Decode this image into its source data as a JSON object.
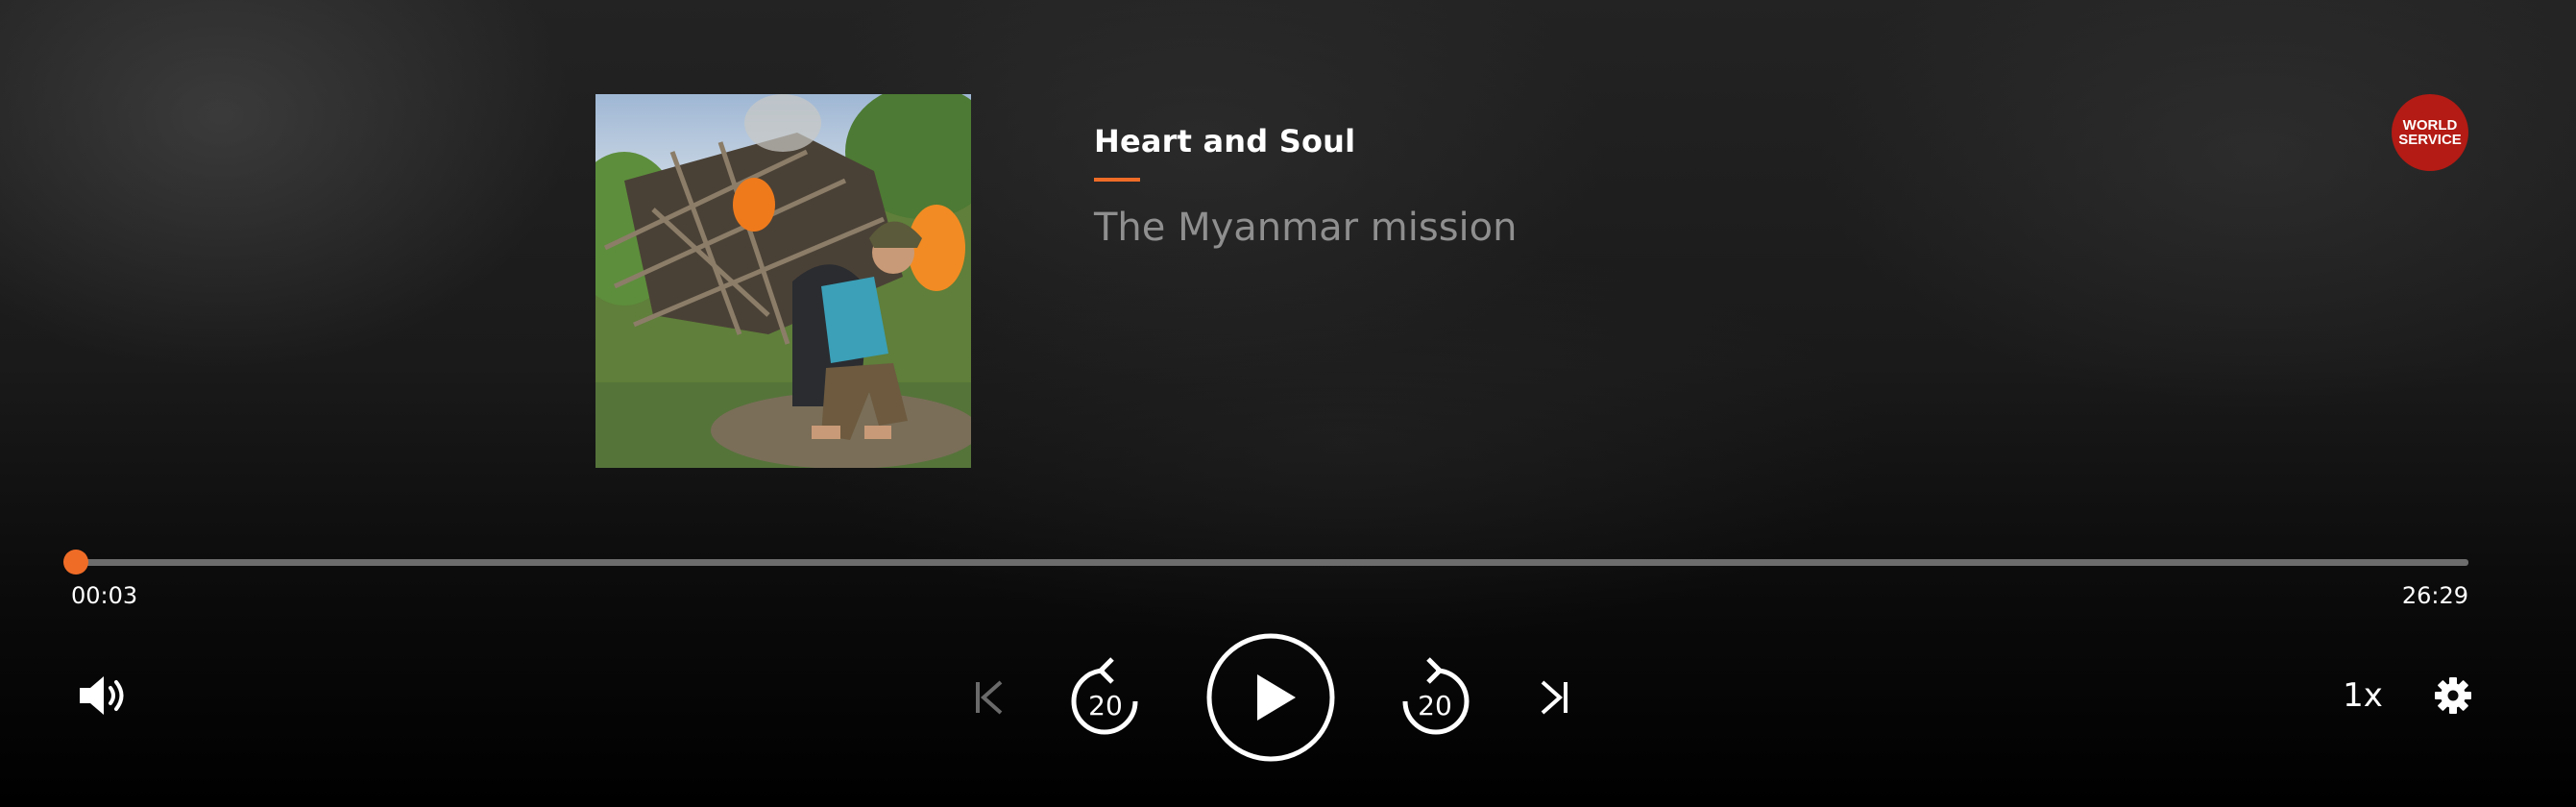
{
  "player": {
    "programme_title": "Heart and Soul",
    "episode_title": "The Myanmar mission",
    "brand_logo": {
      "line1": "WORLD",
      "line2": "SERVICE",
      "color": "#b31b14"
    },
    "accent_color": "#ef6c27",
    "artwork_description": "Photo: person with backpack and hat walking past a burning bamboo hut"
  },
  "playback": {
    "elapsed": "00:03",
    "duration": "26:29",
    "progress_fraction": 0.002,
    "speed_label": "1x",
    "skip_back_seconds": "20",
    "skip_forward_seconds": "20",
    "state": "paused"
  },
  "icons": {
    "volume": "volume-icon",
    "previous": "skip-previous-icon",
    "rewind": "rewind-20-icon",
    "play": "play-icon",
    "forward": "forward-20-icon",
    "next": "skip-next-icon",
    "settings": "gear-icon"
  }
}
